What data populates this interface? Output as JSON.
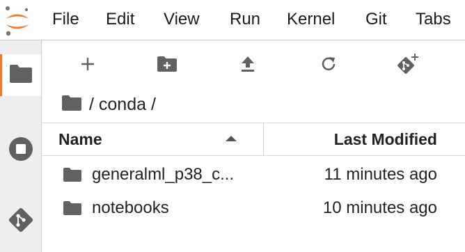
{
  "menubar": {
    "items": [
      "File",
      "Edit",
      "View",
      "Run",
      "Kernel",
      "Git",
      "Tabs"
    ]
  },
  "sidebar": {
    "items": [
      {
        "icon": "folder-icon",
        "active": true
      },
      {
        "icon": "stop-circle-icon",
        "active": false
      },
      {
        "icon": "git-icon",
        "active": false
      }
    ]
  },
  "toolbar": {
    "buttons": [
      {
        "icon": "plus-icon"
      },
      {
        "icon": "new-folder-icon"
      },
      {
        "icon": "upload-icon"
      },
      {
        "icon": "refresh-icon"
      },
      {
        "icon": "git-clone-icon"
      }
    ]
  },
  "breadcrumb": {
    "path": "/ conda /"
  },
  "filelist": {
    "col_name": "Name",
    "col_modified": "Last Modified",
    "rows": [
      {
        "name": "generalml_p38_c...",
        "modified": "11 minutes ago"
      },
      {
        "name": "notebooks",
        "modified": "10 minutes ago"
      }
    ]
  },
  "colors": {
    "accent": "#f37726",
    "icon": "#616161"
  }
}
